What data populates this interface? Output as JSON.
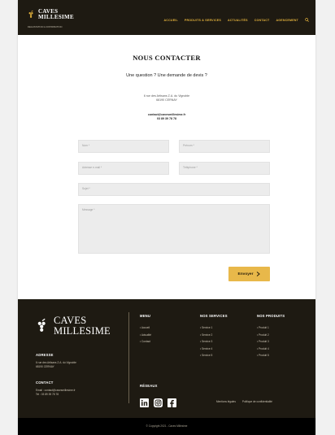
{
  "header": {
    "logo_line1": "CAVES",
    "logo_line2": "MILLESIME",
    "tagline": "DEGUSTATION & DISTRIBUTION",
    "nav": [
      "ACCUEIL",
      "PRODUITS & SERVICES",
      "ACTUALITÉS",
      "CONTACT",
      "AGENCEMENT"
    ]
  },
  "contact": {
    "title": "NOUS CONTACTER",
    "subtitle": "Une question ? Une demande de devis ?",
    "address_line1": "6 rue des Artisans Z.A. du Vignoble",
    "address_line2": "68190 CERNAY",
    "email": "contact@cavesmillesime.fr",
    "phone": "03 89 39 78 78"
  },
  "form": {
    "name": "Nom *",
    "firstname": "Prénom *",
    "email": "Adresse e-mail *",
    "phone": "Téléphone *",
    "subject": "Sujet *",
    "message": "Message *",
    "submit": "Envoyer"
  },
  "footer": {
    "logo_line1": "CAVES",
    "logo_line2": "MILLESIME",
    "address_title": "ADRESSE",
    "address_line1": "6 rue des Artisans Z.A. du Vignoble",
    "address_line2": "68190 CERNAY",
    "contact_title": "CONTACT",
    "email": "Email : contact@cavesmillesime.fr",
    "tel": "Tel : 03 89 39 78 78",
    "menu_title": "MENU",
    "menu": [
      "• Accueil",
      "• Actualité",
      "• Contact"
    ],
    "services_title": "NOS SERVICES",
    "services": [
      "• Service 1",
      "• Service 2",
      "• Service 3",
      "• Service 4",
      "• Service 5"
    ],
    "products_title": "NOS PRODUITS",
    "products": [
      "• Produit 1",
      "• Produit 2",
      "• Produit 3",
      "• Produit 4",
      "• Produit 5"
    ],
    "social_title": "RÉSEAUX",
    "legal": "Mentions légales",
    "privacy": "Politique de confidentialité",
    "copyright": "© Copyright 2021 - Caves Millesime"
  },
  "colors": {
    "accent": "#e8b84a",
    "dark": "#1e1a12"
  }
}
